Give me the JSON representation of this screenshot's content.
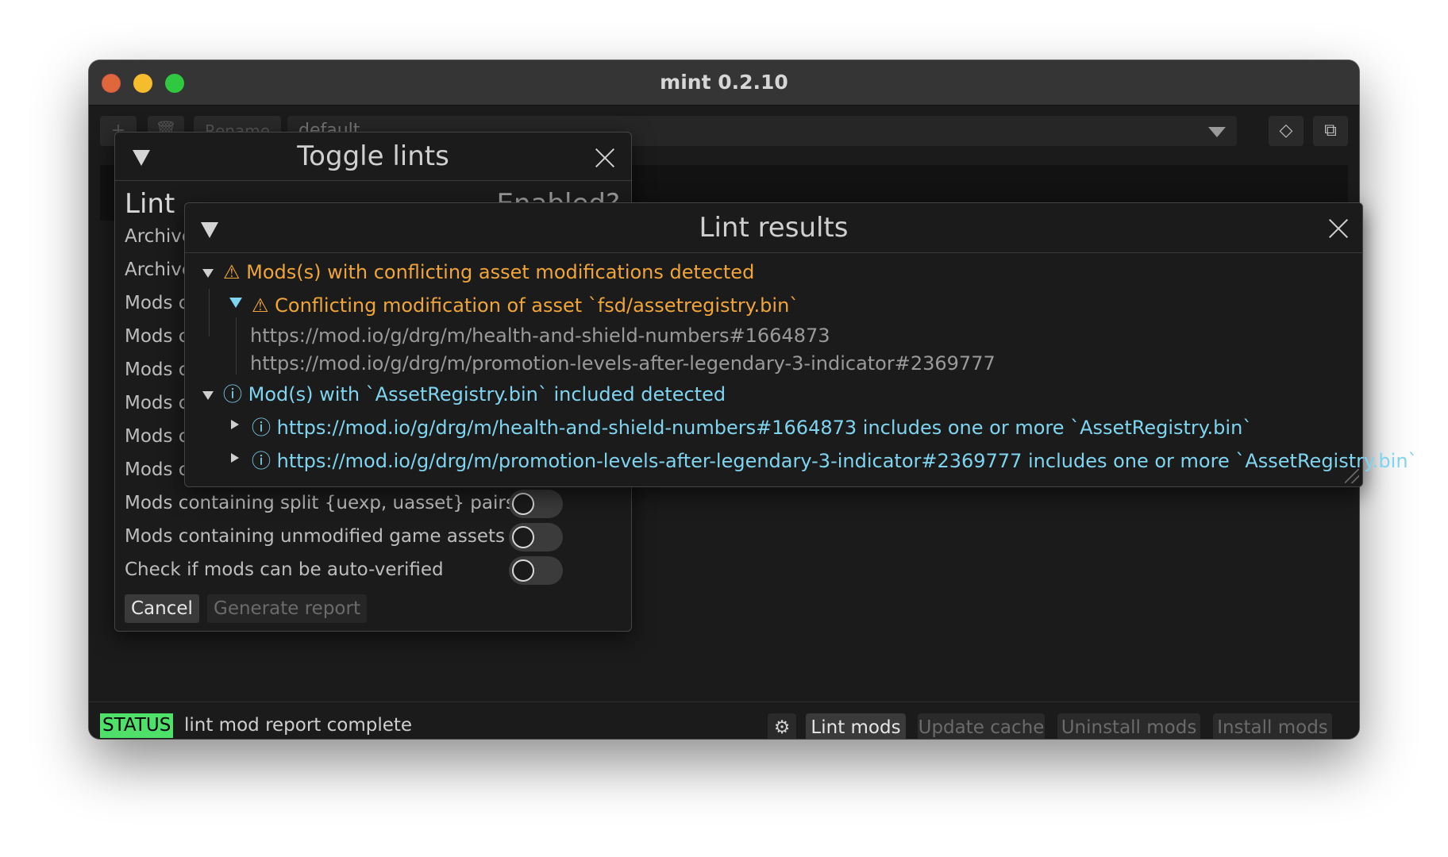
{
  "window": {
    "title": "mint 0.2.10"
  },
  "toolbar": {
    "rename_label": "Rename",
    "profile_value": "default"
  },
  "toggle_lints": {
    "title": "Toggle lints",
    "lint_header": "Lint",
    "enabled_header": "Enabled?",
    "rows": [
      {
        "label": "Archive"
      },
      {
        "label": "Archive"
      },
      {
        "label": "Mods c"
      },
      {
        "label": "Mods c"
      },
      {
        "label": "Mods c"
      },
      {
        "label": "Mods c"
      },
      {
        "label": "Mods c"
      },
      {
        "label": "Mods c"
      },
      {
        "label": "Mods containing split {uexp, uasset} pairs",
        "enabled": false
      },
      {
        "label": "Mods containing unmodified game assets",
        "enabled": false
      },
      {
        "label": "Check if mods can be auto-verified",
        "enabled": false
      }
    ],
    "cancel_label": "Cancel",
    "generate_label": "Generate report"
  },
  "lint_results": {
    "title": "Lint results",
    "groups": [
      {
        "label": "Mods(s) with conflicting asset modifications detected",
        "icon": "warning-icon",
        "children": [
          {
            "label": "Conflicting modification of asset `fsd/assetregistry.bin`",
            "icon": "warning-icon",
            "items": [
              "https://mod.io/g/drg/m/health-and-shield-numbers#1664873",
              "https://mod.io/g/drg/m/promotion-levels-after-legendary-3-indicator#2369777"
            ]
          }
        ]
      },
      {
        "label": "Mod(s) with `AssetRegistry.bin` included detected",
        "icon": "info-icon",
        "children": [
          {
            "label": "https://mod.io/g/drg/m/health-and-shield-numbers#1664873 includes one or more `AssetRegistry.bin`",
            "icon": "info-icon"
          },
          {
            "label": "https://mod.io/g/drg/m/promotion-levels-after-legendary-3-indicator#2369777 includes one or more `AssetRegistry.bin`",
            "icon": "info-icon"
          }
        ]
      }
    ]
  },
  "statusbar": {
    "badge": "STATUS",
    "message": "lint mod report complete",
    "buttons": {
      "lint": "Lint mods",
      "update": "Update cache",
      "uninstall": "Uninstall mods",
      "install": "Install mods"
    }
  },
  "colors": {
    "warning": "#f0a53a",
    "info": "#7fd4f0",
    "status_badge": "#4fe06a"
  }
}
